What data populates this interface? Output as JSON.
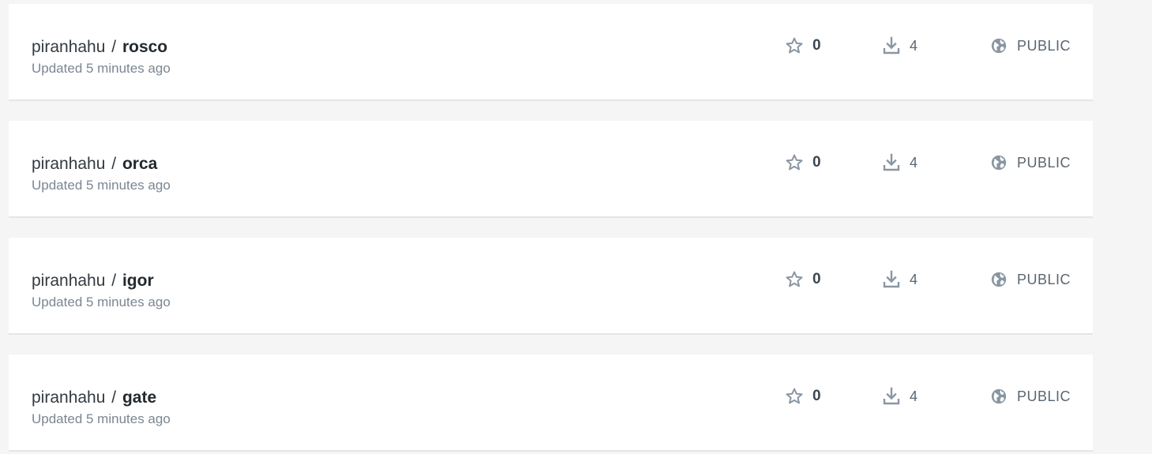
{
  "icons": {
    "star": "star-icon",
    "pulls": "download-icon",
    "visibility": "globe-icon"
  },
  "colors": {
    "background": "#f5f5f5",
    "card": "#ffffff",
    "icon": "#8a96a2",
    "text_primary": "#333a40",
    "text_secondary": "#7b8691"
  },
  "repositories": [
    {
      "namespace": "piranhahu",
      "separator": "/",
      "name": "rosco",
      "updated": "Updated 5 minutes ago",
      "stars": "0",
      "pulls": "4",
      "visibility": "PUBLIC"
    },
    {
      "namespace": "piranhahu",
      "separator": "/",
      "name": "orca",
      "updated": "Updated 5 minutes ago",
      "stars": "0",
      "pulls": "4",
      "visibility": "PUBLIC"
    },
    {
      "namespace": "piranhahu",
      "separator": "/",
      "name": "igor",
      "updated": "Updated 5 minutes ago",
      "stars": "0",
      "pulls": "4",
      "visibility": "PUBLIC"
    },
    {
      "namespace": "piranhahu",
      "separator": "/",
      "name": "gate",
      "updated": "Updated 5 minutes ago",
      "stars": "0",
      "pulls": "4",
      "visibility": "PUBLIC"
    }
  ]
}
